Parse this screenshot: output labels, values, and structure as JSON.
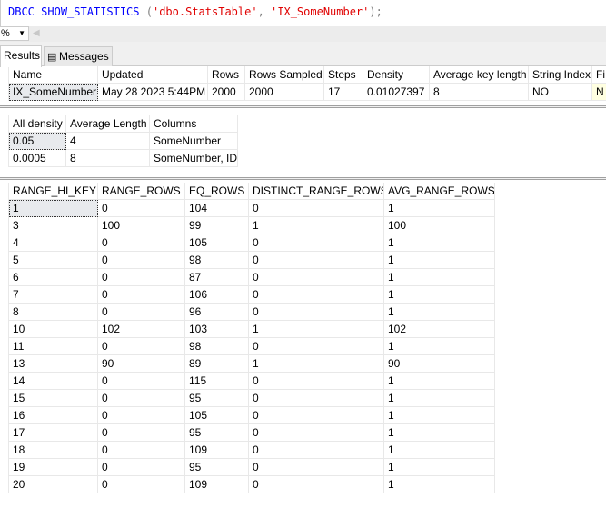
{
  "editor": {
    "kw1": "DBCC",
    "kw2": "SHOW_STATISTICS",
    "open": " (",
    "arg1": "'dbo.StatsTable'",
    "comma": ", ",
    "arg2": "'IX_SomeNumber'",
    "close": ");"
  },
  "zoom": {
    "value": "%"
  },
  "tabs": [
    {
      "label": "Results",
      "active": true
    },
    {
      "label": "Messages",
      "icon": "messages-icon"
    }
  ],
  "header_table": {
    "columns": [
      "Name",
      "Updated",
      "Rows",
      "Rows Sampled",
      "Steps",
      "Density",
      "Average key length",
      "String Index",
      "Fi"
    ],
    "rows": [
      [
        "IX_SomeNumber",
        "May 28 2023  5:44PM",
        "2000",
        "2000",
        "17",
        "0.01027397",
        "8",
        "NO",
        "N"
      ]
    ]
  },
  "density_table": {
    "columns": [
      "All density",
      "Average Length",
      "Columns"
    ],
    "rows": [
      [
        "0.05",
        "4",
        "SomeNumber"
      ],
      [
        "0.0005",
        "8",
        "SomeNumber, ID"
      ]
    ]
  },
  "histogram_table": {
    "columns": [
      "RANGE_HI_KEY",
      "RANGE_ROWS",
      "EQ_ROWS",
      "DISTINCT_RANGE_ROWS",
      "AVG_RANGE_ROWS"
    ],
    "rows": [
      [
        "1",
        "0",
        "104",
        "0",
        "1"
      ],
      [
        "3",
        "100",
        "99",
        "1",
        "100"
      ],
      [
        "4",
        "0",
        "105",
        "0",
        "1"
      ],
      [
        "5",
        "0",
        "98",
        "0",
        "1"
      ],
      [
        "6",
        "0",
        "87",
        "0",
        "1"
      ],
      [
        "7",
        "0",
        "106",
        "0",
        "1"
      ],
      [
        "8",
        "0",
        "96",
        "0",
        "1"
      ],
      [
        "10",
        "102",
        "103",
        "1",
        "102"
      ],
      [
        "11",
        "0",
        "98",
        "0",
        "1"
      ],
      [
        "13",
        "90",
        "89",
        "1",
        "90"
      ],
      [
        "14",
        "0",
        "115",
        "0",
        "1"
      ],
      [
        "15",
        "0",
        "95",
        "0",
        "1"
      ],
      [
        "16",
        "0",
        "105",
        "0",
        "1"
      ],
      [
        "17",
        "0",
        "95",
        "0",
        "1"
      ],
      [
        "18",
        "0",
        "109",
        "0",
        "1"
      ],
      [
        "19",
        "0",
        "95",
        "0",
        "1"
      ],
      [
        "20",
        "0",
        "109",
        "0",
        "1"
      ]
    ]
  },
  "colors": {
    "keyword": "#0000ff",
    "string": "#e00000",
    "null_cell": "#ffffe1"
  }
}
